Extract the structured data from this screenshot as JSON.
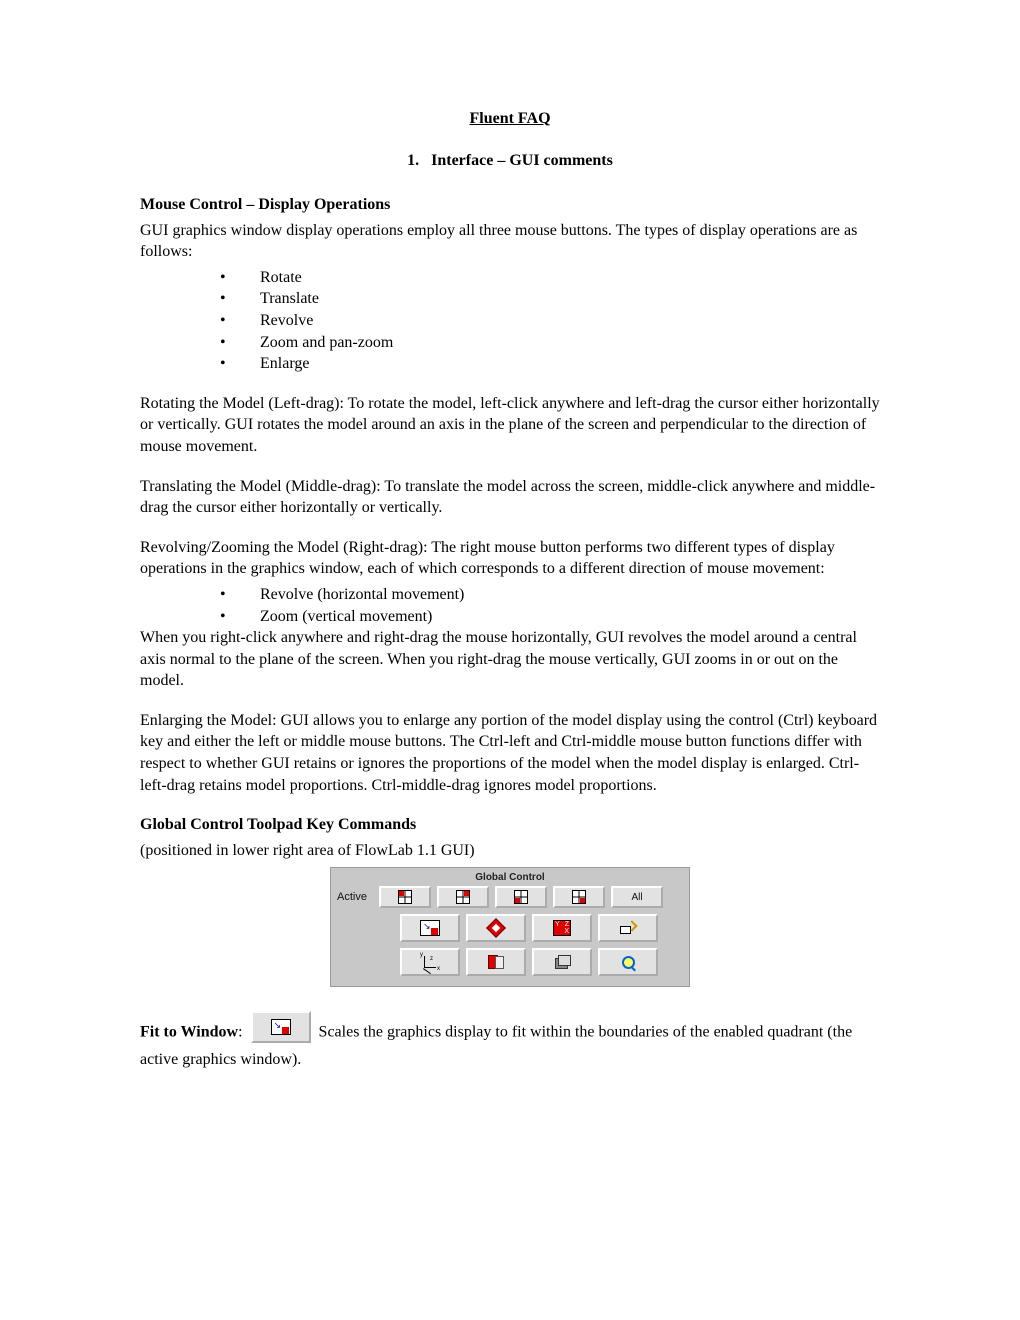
{
  "title": "Fluent FAQ",
  "section": {
    "number": "1.",
    "heading": "Interface – GUI comments"
  },
  "mouse": {
    "heading": "Mouse Control – Display Operations",
    "intro": "GUI graphics window display operations employ all three mouse buttons. The types of display operations are as follows:",
    "ops": [
      "Rotate",
      "Translate",
      "Revolve",
      "Zoom and pan-zoom",
      "Enlarge"
    ],
    "rotate": "Rotating the Model (Left-drag): To rotate the model, left-click anywhere and left-drag the cursor either horizontally or vertically. GUI rotates the model around an axis in the plane of the screen and perpendicular to the direction of mouse movement.",
    "translate": "Translating the Model (Middle-drag): To translate the model across the screen, middle-click anywhere and middle-drag the cursor either horizontally or vertically.",
    "revolve_intro": "Revolving/Zooming the Model (Right-drag): The right mouse button performs two different types of display operations in the graphics window, each of which corresponds to a different direction of mouse movement:",
    "revolve_list": [
      "Revolve (horizontal movement)",
      "Zoom (vertical movement)"
    ],
    "revolve_after": "When you right-click anywhere and right-drag the mouse horizontally, GUI revolves the model around a central axis normal to the plane of the screen. When you right-drag the mouse vertically, GUI zooms in or out on the model.",
    "enlarge": "Enlarging the Model: GUI allows you to enlarge any portion of the model display using the control (Ctrl) keyboard key and either the left or middle mouse buttons. The Ctrl-left and Ctrl-middle mouse button functions differ with respect to whether GUI retains or ignores the proportions of the model when the model display is enlarged. Ctrl-left-drag retains model proportions. Ctrl-middle-drag ignores model proportions."
  },
  "toolpad": {
    "heading": "Global Control Toolpad Key Commands",
    "note": "(positioned in lower right area of FlowLab 1.1 GUI)",
    "title": "Global Control",
    "active_label": "Active",
    "all_label": "All"
  },
  "fit": {
    "label": "Fit to Window",
    "colon": ": ",
    "text": "Scales the graphics display to fit within the boundaries of the enabled quadrant (the active graphics window)."
  }
}
